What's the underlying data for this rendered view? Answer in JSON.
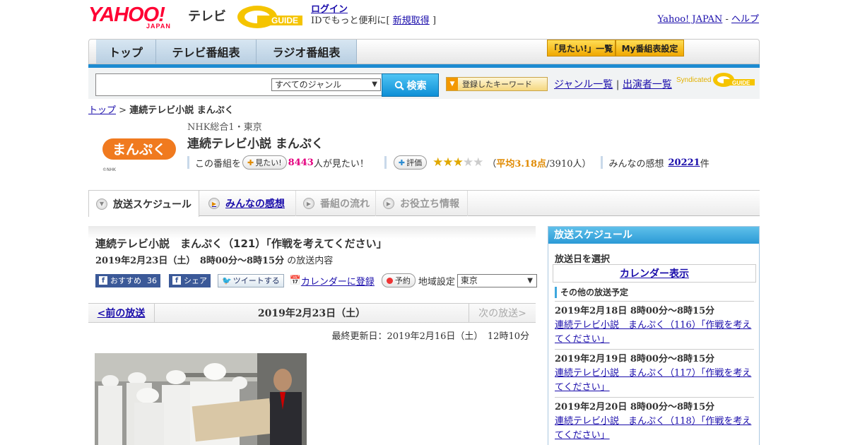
{
  "header": {
    "logo_text": "YAHOO!",
    "logo_sub": "JAPAN",
    "service": "テレビ",
    "gguide": "G GUIDE",
    "login": "ログイン",
    "login_note_prefix": "IDでもっと便利に[",
    "signup": "新規取得",
    "login_note_suffix": "]",
    "yahoo_japan": "Yahoo! JAPAN",
    "separator": "-",
    "help": "ヘルプ"
  },
  "nav": {
    "tabs": [
      {
        "label": "トップ"
      },
      {
        "label": "テレビ番組表"
      },
      {
        "label": "ラジオ番組表"
      }
    ],
    "mitai_list": "「見たい!」一覧",
    "my_guide": "My番組表設定"
  },
  "search": {
    "placeholder": "",
    "genre": "すべてのジャンル",
    "button": "検索",
    "keyword_button": "登録したキーワード",
    "genre_list": "ジャンル一覧",
    "divider": "|",
    "performer_list": "出演者一覧",
    "syndicated": "Syndicated",
    "syndicated_logo": "G GUIDE"
  },
  "breadcrumb": {
    "top": "トップ",
    "sep": ">",
    "current": "連続テレビ小説 まんぷく"
  },
  "program": {
    "logo_text": "まんぷく",
    "logo_copyright": "©NHK",
    "channel": "NHK総合1・東京",
    "title": "連続テレビ小説 まんぷく",
    "watch_prefix": "この番組を",
    "watch_button": "見たい!",
    "watch_count": "8443",
    "watch_suffix": "人が見たい！",
    "rating_button": "評価",
    "rating": 3.18,
    "rating_open": "（",
    "rating_avg": "平均3.18点",
    "rating_count": "/3910人）",
    "impressions_prefix": "みんなの感想",
    "impressions_count": "20221",
    "impressions_suffix": "件"
  },
  "tabs": [
    {
      "label": "放送スケジュール"
    },
    {
      "label": "みんなの感想"
    },
    {
      "label": "番組の流れ"
    },
    {
      "label": "お役立ち情報"
    }
  ],
  "episode": {
    "title": "連続テレビ小説　まんぷく（121）「作戦を考えてください」",
    "date": "2019年2月23日（土）　8時00分～8時15分",
    "date_suffix": "の放送内容",
    "recommend": "おすすめ",
    "recommend_count": "36",
    "share": "シェア",
    "tweet": "ツイートする",
    "calendar": "カレンダーに登録",
    "reserve": "予約",
    "region_label": "地域設定",
    "region": "東京",
    "prev": "<前の放送",
    "current_date": "2019年2月23日（土）",
    "next": "次の放送>",
    "updated": "最終更新日：2019年2月16日（土）　12時10分"
  },
  "sidebar": {
    "title": "放送スケジュール",
    "select_label": "放送日を選択",
    "calendar": "カレンダー表示",
    "other_label": "その他の放送予定",
    "items": [
      {
        "date": "2019年2月18日  8時00分～8時15分",
        "title": "連続テレビ小説　まんぷく（116）「作戦を考えてください」"
      },
      {
        "date": "2019年2月19日  8時00分～8時15分",
        "title": "連続テレビ小説　まんぷく（117）「作戦を考えてください」"
      },
      {
        "date": "2019年2月20日  8時00分～8時15分",
        "title": "連続テレビ小説　まんぷく（118）「作戦を考えてください」"
      }
    ]
  },
  "colors": {
    "brand_red": "#ff0033",
    "accent_blue": "#1d8bd1",
    "link": "#1a0dab",
    "star": "#e0a800"
  }
}
